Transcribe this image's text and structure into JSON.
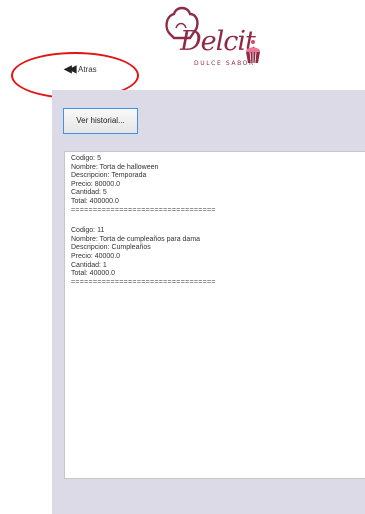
{
  "logo": {
    "brand_text": "Delcit",
    "sub_text": "DULCE SABOR"
  },
  "nav": {
    "back_icon": "◀◀",
    "back_label": "Atras"
  },
  "toolbar": {
    "history_button_label": "Ver historial..."
  },
  "records": [
    {
      "codigo": "Codigo: 5",
      "nombre": "Nombre: Torta de halloween",
      "descripcion": "Descripcion: Temporada",
      "precio": "Precio: 80000.0",
      "cantidad": "Cantidad: 5",
      "total": "Total: 400000.0",
      "separator": "================================="
    },
    {
      "codigo": "Codigo: 11",
      "nombre": "Nombre: Torta de cumpleaños para dama",
      "descripcion": "Descripcion: Cumpleaños",
      "precio": "Precio: 40000.0",
      "cantidad": "Cantidad: 1",
      "total": "Total: 40000.0",
      "separator": "================================="
    }
  ],
  "colors": {
    "brand": "#8e2c47",
    "annotation_ring": "#e11414",
    "panel": "#dddae8",
    "button_border": "#4a90d9"
  }
}
